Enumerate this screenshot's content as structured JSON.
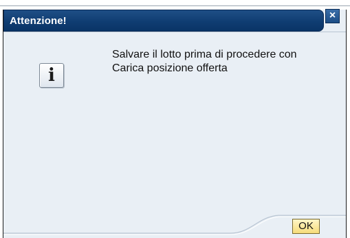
{
  "dialog": {
    "title": "Attenzione!",
    "close_label": "×",
    "icon_name": "info-icon",
    "icon_glyph": "i",
    "message_lines": [
      "Salvare il lotto prima di procedere con",
      "Carica posizione offerta"
    ],
    "ok_label": "OK"
  },
  "colors": {
    "title_bar": "#0f3d72",
    "dialog_bg": "#e9eff5",
    "ok_button": "#f6dc7a"
  }
}
